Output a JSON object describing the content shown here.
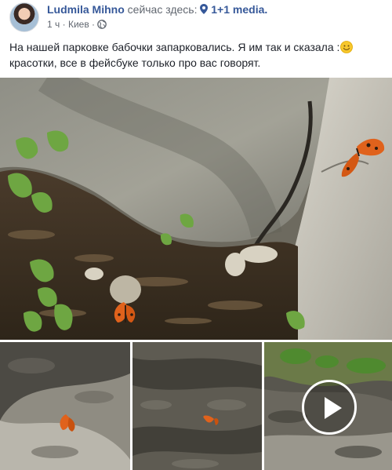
{
  "post": {
    "author": "Ludmila Mihno",
    "here_text": "сейчас здесь:",
    "place": "1+1 media.",
    "time": "1 ч",
    "separator": "·",
    "city": "Киев",
    "text_part1": "На нашей парковке бабочки запарковались. Я им так и сказала :",
    "text_part2": " красотки, все в фейсбуке только про вас говорят."
  },
  "icons": {
    "location": "location-pin-icon",
    "privacy": "globe-icon",
    "emoji": "smiley-emoji-icon",
    "video": "play-icon"
  },
  "colors": {
    "link": "#365899",
    "meta": "#616770",
    "text": "#1d2129",
    "butterfly": "#e0621c"
  }
}
